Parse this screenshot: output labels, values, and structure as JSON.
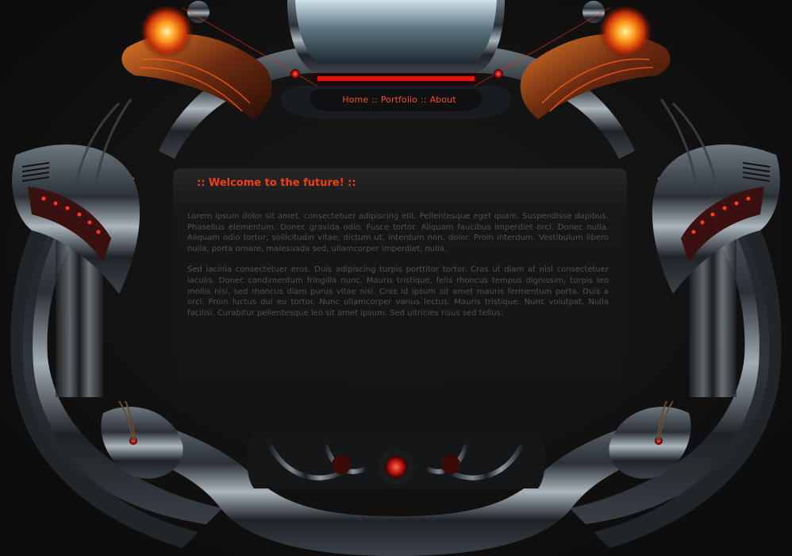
{
  "nav": {
    "home": "Home",
    "portfolio": "Portfolio",
    "about": "About",
    "separator": "::"
  },
  "content": {
    "title": ":: Welcome to the future! ::",
    "paragraphs": [
      "Lorem ipsum dolor sit amet, consectetuer adipiscing elit. Pellentesque eget quam. Suspendisse dapibus. Phasellus elementum. Donec gravida odio. Fusce tortor. Aliquam faucibus imperdiet orci. Donec nulla. Aliquam odio tortor, sollicitudin vitae, dictum ut, interdum non, dolor. Proin interdum. Vestibulum libero nulla, porta ornare, malesuada sed, ullamcorper imperdiet, nulla.",
      "Sed lacinia consectetuer eros. Duis adipiscing turpis porttitor tortor. Cras ut diam at nisl consectetuer iaculis. Donec condimentum fringilla nunc. Mauris tristique, felis rhoncus tempus dignissim, turpis leo mollis nisi, sed rhoncus diam purus vitae nisi. Cras id ipsum sit amet mauris fermentum porta. Duis a orci. Proin luctus dui eu tortor. Nunc ullamcorper varius lectus. Mauris tristique. Nunc volutpat. Nulla facilisi. Curabitur pellentesque leo sit amet ipsum. Sed ultricies risus sed tellus."
    ]
  },
  "colors": {
    "background": "#121212",
    "accent": "#f03f12",
    "nav_text": "#ff4a1c",
    "body_text": "#505050"
  }
}
